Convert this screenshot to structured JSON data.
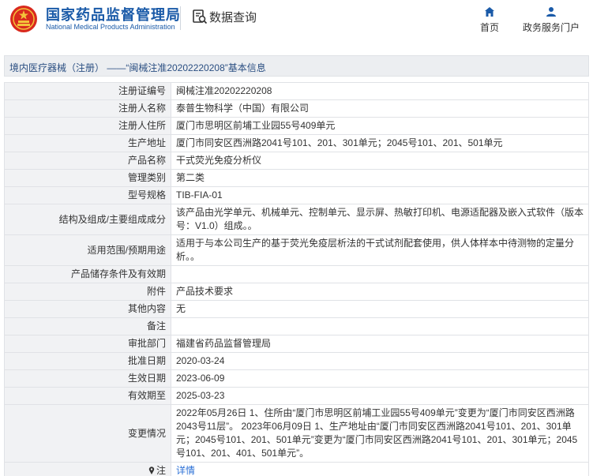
{
  "header": {
    "brand_cn": "国家药品监督管理局",
    "brand_en": "National Medical Products Administration",
    "query_label": "数据查询",
    "nav": [
      {
        "label": "首页",
        "icon": "home-icon"
      },
      {
        "label": "政务服务门户",
        "icon": "user-icon"
      }
    ]
  },
  "title_bar": {
    "text": "境内医疗器械（注册） ——“闽械注准20202220208”基本信息"
  },
  "rows": [
    {
      "key": "注册证编号",
      "value": "闽械注准20202220208"
    },
    {
      "key": "注册人名称",
      "value": "泰普生物科学（中国）有限公司"
    },
    {
      "key": "注册人住所",
      "value": "厦门市思明区前埔工业园55号409单元"
    },
    {
      "key": "生产地址",
      "value": "厦门市同安区西洲路2041号101、201、301单元；2045号101、201、501单元"
    },
    {
      "key": "产品名称",
      "value": "干式荧光免疫分析仪"
    },
    {
      "key": "管理类别",
      "value": "第二类"
    },
    {
      "key": "型号规格",
      "value": "TIB-FIA-01"
    },
    {
      "key": "结构及组成/主要组成成分",
      "value": "该产品由光学单元、机械单元、控制单元、显示屏、热敏打印机、电源适配器及嵌入式软件（版本号：V1.0）组成。。"
    },
    {
      "key": "适用范围/预期用途",
      "value": "适用于与本公司生产的基于荧光免疫层析法的干式试剂配套使用，供人体样本中待测物的定量分析。。"
    },
    {
      "key": "产品储存条件及有效期",
      "value": ""
    },
    {
      "key": "附件",
      "value": "产品技术要求"
    },
    {
      "key": "其他内容",
      "value": "无"
    },
    {
      "key": "备注",
      "value": ""
    },
    {
      "key": "审批部门",
      "value": "福建省药品监督管理局"
    },
    {
      "key": "批准日期",
      "value": "2020-03-24"
    },
    {
      "key": "生效日期",
      "value": "2023-06-09"
    },
    {
      "key": "有效期至",
      "value": "2025-03-23"
    },
    {
      "key": "变更情况",
      "value": "2022年05月26日 1、住所由“厦门市思明区前埔工业园55号409单元”变更为“厦门市同安区西洲路2043号11层”。 2023年06月09日 1、生产地址由“厦门市同安区西洲路2041号101、201、301单元；2045号101、201、501单元”变更为“厦门市同安区西洲路2041号101、201、301单元；2045号101、201、401、501单元”。"
    },
    {
      "key": "注",
      "value": "详情"
    }
  ]
}
